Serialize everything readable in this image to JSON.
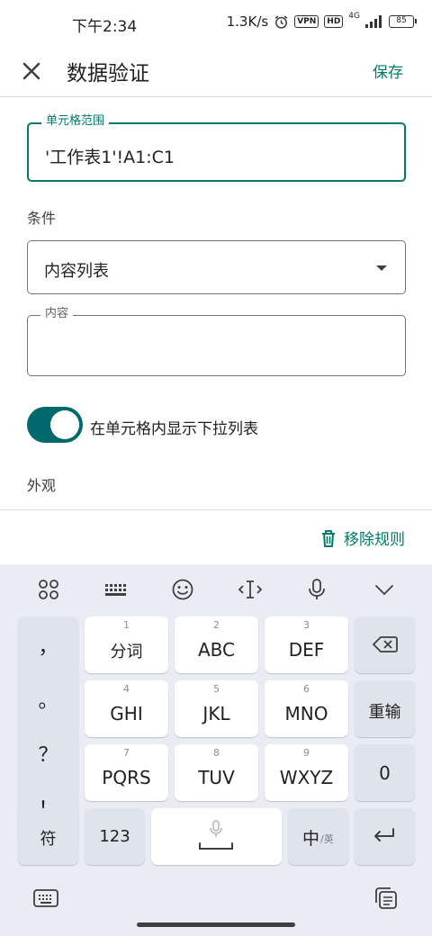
{
  "status_bar": {
    "time": "下午2:34",
    "speed": "1.3K/s",
    "vpn": "VPN",
    "hd": "HD",
    "signal": "4G",
    "battery": "85"
  },
  "header": {
    "title": "数据验证",
    "save_label": "保存"
  },
  "form": {
    "range_label": "单元格范围",
    "range_value": "'工作表1'!A1:C1",
    "condition_label": "条件",
    "condition_value": "内容列表",
    "content_label": "内容",
    "content_value": "",
    "toggle_label": "在单元格内显示下拉列表",
    "toggle_on": true,
    "appearance_label": "外观",
    "remove_label": "移除规则"
  },
  "colors": {
    "accent": "#00796b",
    "toggle": "#00696b"
  },
  "keyboard": {
    "toolbar_icons": [
      "grid-icon",
      "keyboard-icon",
      "emoji-icon",
      "cursor-icon",
      "mic-icon",
      "chevron-down-icon"
    ],
    "punctuation": [
      "，",
      "。",
      "？",
      "！"
    ],
    "keys": {
      "k1": {
        "num": "1",
        "label": "分词"
      },
      "k2": {
        "num": "2",
        "label": "ABC"
      },
      "k3": {
        "num": "3",
        "label": "DEF"
      },
      "k4": {
        "num": "4",
        "label": "GHI"
      },
      "k5": {
        "num": "5",
        "label": "JKL"
      },
      "k6": {
        "num": "6",
        "label": "MNO"
      },
      "k7": {
        "num": "7",
        "label": "PQRS"
      },
      "k8": {
        "num": "8",
        "label": "TUV"
      },
      "k9": {
        "num": "9",
        "label": "WXYZ"
      }
    },
    "reinput": "重输",
    "zero": "0",
    "symbol": "符",
    "numeric": "123",
    "lang_main": "中",
    "lang_alt": "/英"
  }
}
